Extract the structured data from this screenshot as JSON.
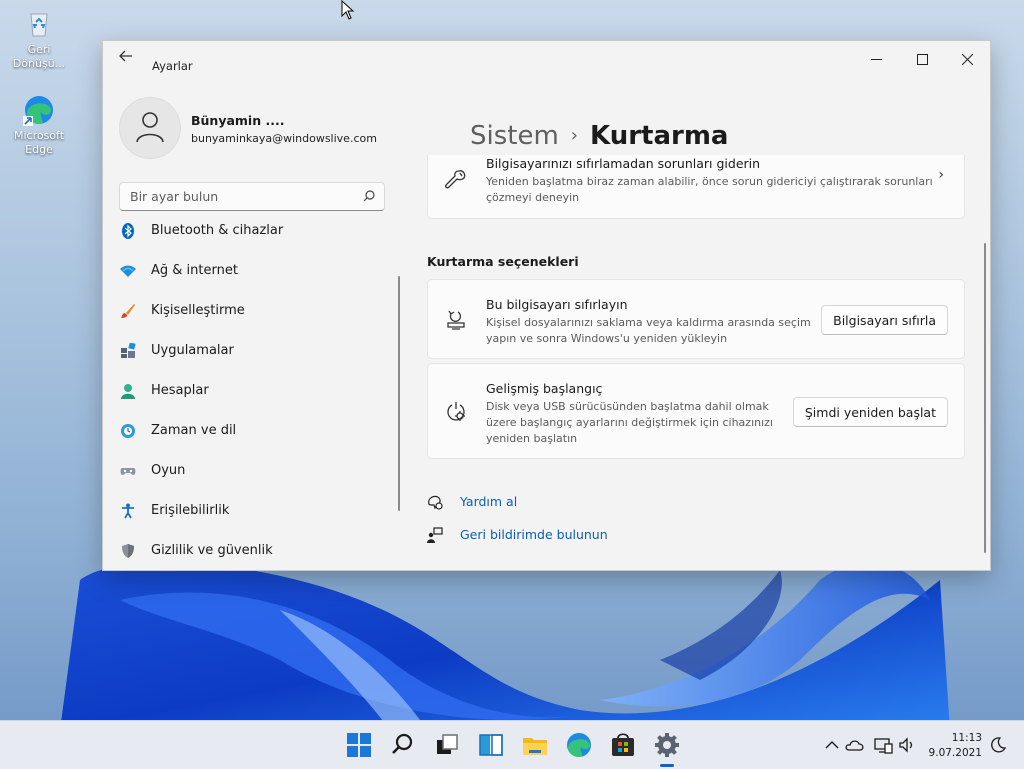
{
  "desktop": {
    "recycle_bin_label": "Geri Dönüşü...",
    "edge_label": "Microsoft Edge"
  },
  "window": {
    "app_title": "Ayarlar",
    "controls": {
      "minimize": "—",
      "maximize": "☐",
      "close": "✕"
    }
  },
  "profile": {
    "name": "Bünyamin ....",
    "email": "bunyaminkaya@windowslive.com"
  },
  "search": {
    "placeholder": "Bir ayar bulun"
  },
  "sidebar": {
    "items": [
      {
        "label": "Bluetooth & cihazlar",
        "icon": "bluetooth-icon"
      },
      {
        "label": "Ağ & internet",
        "icon": "wifi-icon"
      },
      {
        "label": "Kişiselleştirme",
        "icon": "brush-icon"
      },
      {
        "label": "Uygulamalar",
        "icon": "apps-icon"
      },
      {
        "label": "Hesaplar",
        "icon": "person-icon"
      },
      {
        "label": "Zaman ve dil",
        "icon": "globe-clock-icon"
      },
      {
        "label": "Oyun",
        "icon": "gamepad-icon"
      },
      {
        "label": "Erişilebilirlik",
        "icon": "accessibility-icon"
      },
      {
        "label": "Gizlilik ve güvenlik",
        "icon": "shield-icon"
      }
    ]
  },
  "main": {
    "breadcrumb_parent": "Sistem",
    "breadcrumb_separator": "›",
    "breadcrumb_current": "Kurtarma",
    "troubleshoot_card": {
      "title": "Bilgisayarınızı sıfırlamadan sorunları giderin",
      "desc_line1": "Yeniden başlatma biraz zaman alabilir, önce sorun gidericiyi çalıştırarak sorunları",
      "desc_line2": "çözmeyi deneyin",
      "chevron": "›"
    },
    "section_title": "Kurtarma seçenekleri",
    "reset_card": {
      "title": "Bu bilgisayarı sıfırlayın",
      "desc_line1": "Kişisel dosyalarınızı saklama veya kaldırma arasında seçim",
      "desc_line2": "yapın ve sonra Windows'u yeniden yükleyin",
      "button": "Bilgisayarı sıfırla"
    },
    "advanced_card": {
      "title": "Gelişmiş başlangıç",
      "desc_line1": "Disk veya USB sürücüsünden başlatma dahil olmak",
      "desc_line2": "üzere başlangıç ayarlarını değiştirmek için cihazınızı",
      "desc_line3": "yeniden başlatın",
      "button": "Şimdi yeniden başlat"
    },
    "links": {
      "help": "Yardım al",
      "feedback": "Geri bildirimde bulunun"
    }
  },
  "taskbar": {
    "apps": [
      "start-icon",
      "search-icon",
      "task-view-icon",
      "widgets-icon",
      "file-explorer-icon",
      "edge-icon",
      "store-icon",
      "settings-icon"
    ],
    "time": "11:13",
    "date": "9.07.2021"
  },
  "colors": {
    "accent": "#0a5fb4",
    "window_bg": "#f3f3f3",
    "card_bg": "#fbfbfb"
  }
}
